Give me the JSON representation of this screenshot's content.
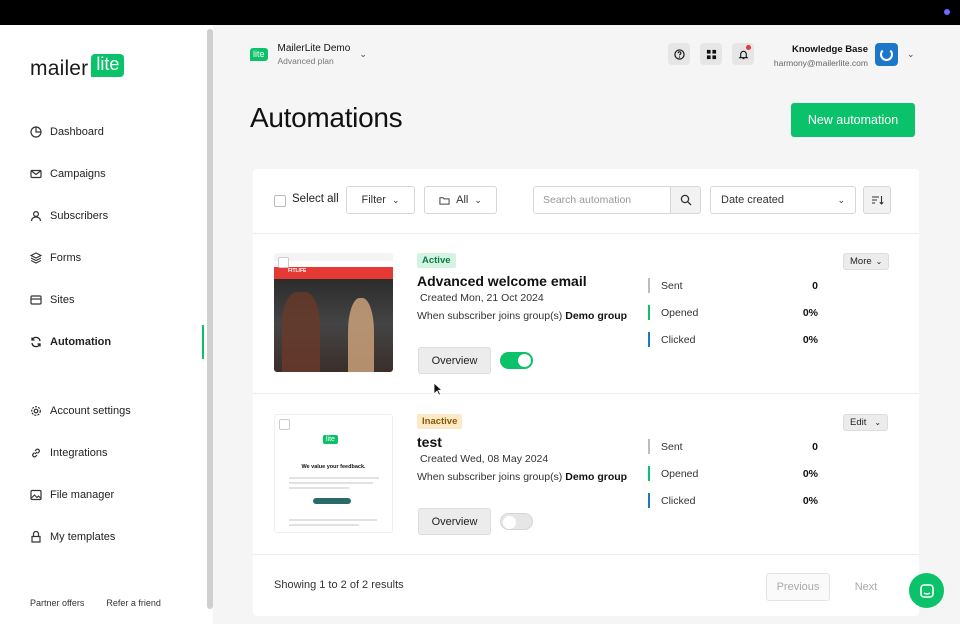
{
  "brand": {
    "word": "mailer",
    "badge": "lite"
  },
  "sidebar": {
    "items": [
      {
        "label": "Dashboard",
        "icon": "dashboard-icon"
      },
      {
        "label": "Campaigns",
        "icon": "mail-icon"
      },
      {
        "label": "Subscribers",
        "icon": "user-icon"
      },
      {
        "label": "Forms",
        "icon": "layers-icon"
      },
      {
        "label": "Sites",
        "icon": "browser-icon"
      },
      {
        "label": "Automation",
        "icon": "refresh-icon",
        "active": true
      },
      {
        "label": "Account settings",
        "icon": "gear-icon"
      },
      {
        "label": "Integrations",
        "icon": "link-icon"
      },
      {
        "label": "File manager",
        "icon": "image-icon"
      },
      {
        "label": "My templates",
        "icon": "template-icon"
      }
    ],
    "footer": [
      "Partner offers",
      "Refer a friend"
    ]
  },
  "header": {
    "account_badge": "lite",
    "account_name": "MailerLite Demo",
    "account_plan": "Advanced plan",
    "user_name": "Knowledge Base",
    "user_email": "harmony@mailerlite.com"
  },
  "page": {
    "title": "Automations",
    "new_button": "New automation"
  },
  "filters": {
    "select_all": "Select all",
    "filter": "Filter",
    "folder": "All",
    "search_placeholder": "Search automation",
    "sort": "Date created"
  },
  "automations": [
    {
      "status": "Active",
      "title": "Advanced welcome email",
      "created": "Created Mon, 21 Oct 2024",
      "trigger_prefix": "When subscriber joins group(s) ",
      "trigger_group": "Demo group",
      "overview": "Overview",
      "enabled": true,
      "action": "More",
      "thumb_brand": "FITLIFE",
      "stats": [
        {
          "label": "Sent",
          "value": "0"
        },
        {
          "label": "Opened",
          "value": "0%"
        },
        {
          "label": "Clicked",
          "value": "0%"
        }
      ]
    },
    {
      "status": "Inactive",
      "title": "test",
      "created": "Created Wed, 08 May 2024",
      "trigger_prefix": "When subscriber joins group(s) ",
      "trigger_group": "Demo group",
      "overview": "Overview",
      "enabled": false,
      "action": "Edit",
      "thumb_logo": "lite",
      "thumb_headline": "We value your feedback.",
      "stats": [
        {
          "label": "Sent",
          "value": "0"
        },
        {
          "label": "Opened",
          "value": "0%"
        },
        {
          "label": "Clicked",
          "value": "0%"
        }
      ]
    }
  ],
  "stat_colors": [
    "#bdbdbd",
    "#09c269",
    "#1d77c9"
  ],
  "pagination": {
    "summary": "Showing 1 to 2 of 2 results",
    "previous": "Previous",
    "next": "Next"
  },
  "colors": {
    "accent": "#09c269",
    "avatar": "#1d77c9"
  }
}
